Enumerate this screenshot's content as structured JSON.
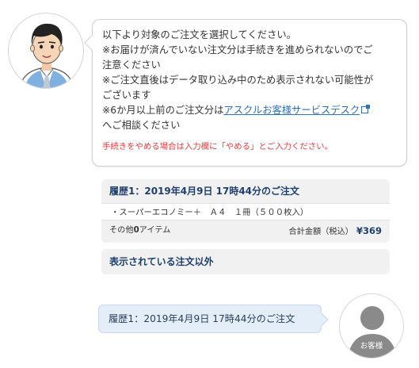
{
  "operator": {
    "avatar_icon": "operator-avatar-icon",
    "lines": {
      "l1": "以下より対象のご注文を選択してください。",
      "l2": "※お届けが済んでいない注文分は手続きを進められないのでご",
      "l3": "注意ください",
      "l4": "※ご注文直後はデータ取り込み中のため表示されない可能性が",
      "l5": "ございます",
      "l6_pre": "※6か月以上前のご注文分は",
      "l6_link": "アスクルお客様サービスデスク",
      "l7": "へご相談ください"
    },
    "warning": "手続きをやめる場合は入力欄に「やめる」とご入力ください。"
  },
  "order": {
    "header": "履歴1：2019年4月9日 17時44分のご注文",
    "item": "・スーパーエコノミー＋　Ａ４　１冊（５００枚入）",
    "others_pre": "その他",
    "others_count": "0",
    "others_post": "アイテム",
    "total_label": "合計金額（税込）",
    "total_value": "¥369"
  },
  "other_orders_label": "表示されている注文以外",
  "customer": {
    "message": "履歴1：2019年4月9日 17時44分のご注文",
    "avatar_label": "お客様"
  },
  "colors": {
    "accent": "#1f3f6e",
    "link": "#2f6fb7",
    "warning": "#e83b3b",
    "customer_bubble": "#e4eef9",
    "card_bg": "#f1f1f1"
  }
}
